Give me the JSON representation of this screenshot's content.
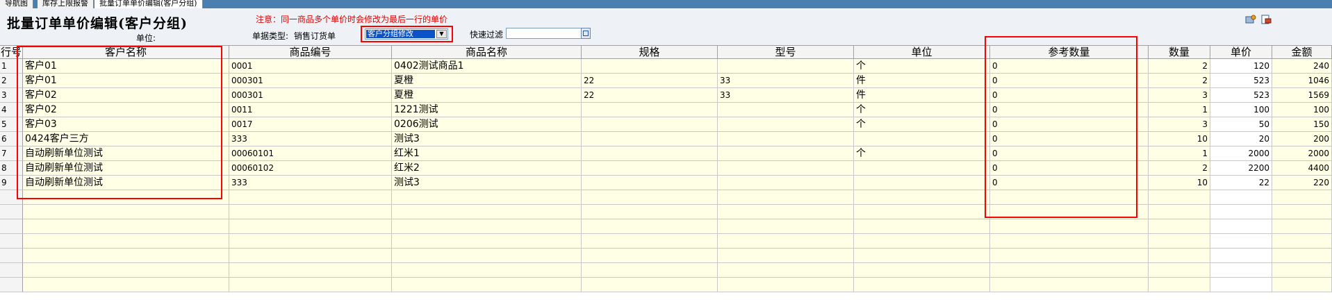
{
  "tabs": [
    {
      "label": "导航图"
    },
    {
      "label": "库存上限报警"
    },
    {
      "label": "批量订单单价编辑(客户分组)"
    }
  ],
  "header": {
    "title": "批量订单单价编辑(客户分组)",
    "notice": "注意：同一商品多个单价时会修改为最后一行的单价",
    "unit_label": "单位:",
    "doc_type_label": "单据类型:",
    "doc_type_value": "销售订货单",
    "mode_select_value": "客户分组修改",
    "filter_label": "快速过滤",
    "filter_value": ""
  },
  "icons": {
    "toolbar_1": "tool-icon",
    "toolbar_2": "export-icon",
    "dropdown": "chevron-down-icon",
    "filter": "search-icon"
  },
  "colors": {
    "tab_bar": "#4a7fb0",
    "notice": "#e00000",
    "highlight": "#ff0000",
    "cell_yellow": "#ffffe6",
    "select_blue": "#0a52c6"
  },
  "table": {
    "columns": [
      "行号",
      "客户名称",
      "商品编号",
      "商品名称",
      "规格",
      "型号",
      "单位",
      "参考数量",
      "数量",
      "单价",
      "金额"
    ],
    "rows": [
      {
        "no": "1",
        "customer": "客户01",
        "code": "0001",
        "name": "0402测试商品1",
        "spec": "",
        "model": "",
        "unit": "个",
        "ref_qty": "0",
        "qty": "2",
        "price": "120",
        "amount": "240"
      },
      {
        "no": "2",
        "customer": "客户01",
        "code": "000301",
        "name": "夏橙",
        "spec": "22",
        "model": "33",
        "unit": "件",
        "ref_qty": "0",
        "qty": "2",
        "price": "523",
        "amount": "1046"
      },
      {
        "no": "3",
        "customer": "客户02",
        "code": "000301",
        "name": "夏橙",
        "spec": "22",
        "model": "33",
        "unit": "件",
        "ref_qty": "0",
        "qty": "3",
        "price": "523",
        "amount": "1569"
      },
      {
        "no": "4",
        "customer": "客户02",
        "code": "0011",
        "name": "1221测试",
        "spec": "",
        "model": "",
        "unit": "个",
        "ref_qty": "0",
        "qty": "1",
        "price": "100",
        "amount": "100"
      },
      {
        "no": "5",
        "customer": "客户03",
        "code": "0017",
        "name": "0206测试",
        "spec": "",
        "model": "",
        "unit": "个",
        "ref_qty": "0",
        "qty": "3",
        "price": "50",
        "amount": "150"
      },
      {
        "no": "6",
        "customer": "0424客户三方",
        "code": "333",
        "name": "测试3",
        "spec": "",
        "model": "",
        "unit": "",
        "ref_qty": "0",
        "qty": "10",
        "price": "20",
        "amount": "200"
      },
      {
        "no": "7",
        "customer": "自动刷新单位测试",
        "code": "00060101",
        "name": "红米1",
        "spec": "",
        "model": "",
        "unit": "个",
        "ref_qty": "0",
        "qty": "1",
        "price": "2000",
        "amount": "2000"
      },
      {
        "no": "8",
        "customer": "自动刷新单位测试",
        "code": "00060102",
        "name": "红米2",
        "spec": "",
        "model": "",
        "unit": "",
        "ref_qty": "0",
        "qty": "2",
        "price": "2200",
        "amount": "4400"
      },
      {
        "no": "9",
        "customer": "自动刷新单位测试",
        "code": "333",
        "name": "测试3",
        "spec": "",
        "model": "",
        "unit": "",
        "ref_qty": "0",
        "qty": "10",
        "price": "22",
        "amount": "220"
      }
    ]
  }
}
